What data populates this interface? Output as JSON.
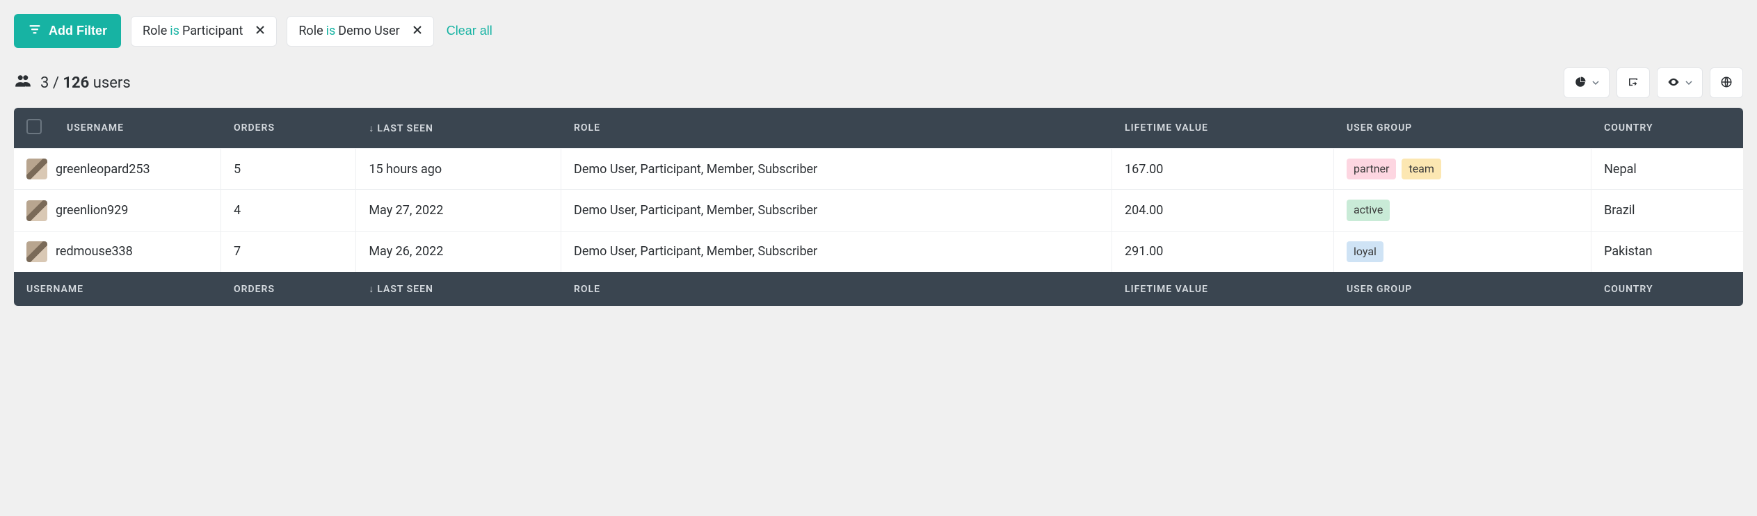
{
  "toolbar": {
    "add_filter_label": "Add Filter",
    "clear_all_label": "Clear all"
  },
  "filters": [
    {
      "field": "Role",
      "operator": "is",
      "value": "Participant"
    },
    {
      "field": "Role",
      "operator": "is",
      "value": "Demo User"
    }
  ],
  "count": {
    "shown": "3",
    "separator": "/",
    "total": "126",
    "noun": "users"
  },
  "columns": {
    "username": "USERNAME",
    "orders": "ORDERS",
    "last_seen": "LAST SEEN",
    "role": "ROLE",
    "lifetime_value": "LIFETIME VALUE",
    "user_group": "USER GROUP",
    "country": "COUNTRY",
    "sort_indicator": "↓"
  },
  "rows": [
    {
      "username": "greenleopard253",
      "orders": "5",
      "last_seen": "15 hours ago",
      "role": "Demo User, Participant, Member, Subscriber",
      "lifetime_value": "167.00",
      "user_group": [
        {
          "label": "partner",
          "cls": "partner"
        },
        {
          "label": "team",
          "cls": "team"
        }
      ],
      "country": "Nepal"
    },
    {
      "username": "greenlion929",
      "orders": "4",
      "last_seen": "May 27, 2022",
      "role": "Demo User, Participant, Member, Subscriber",
      "lifetime_value": "204.00",
      "user_group": [
        {
          "label": "active",
          "cls": "active"
        }
      ],
      "country": "Brazil"
    },
    {
      "username": "redmouse338",
      "orders": "7",
      "last_seen": "May 26, 2022",
      "role": "Demo User, Participant, Member, Subscriber",
      "lifetime_value": "291.00",
      "user_group": [
        {
          "label": "loyal",
          "cls": "loyal"
        }
      ],
      "country": "Pakistan"
    }
  ]
}
